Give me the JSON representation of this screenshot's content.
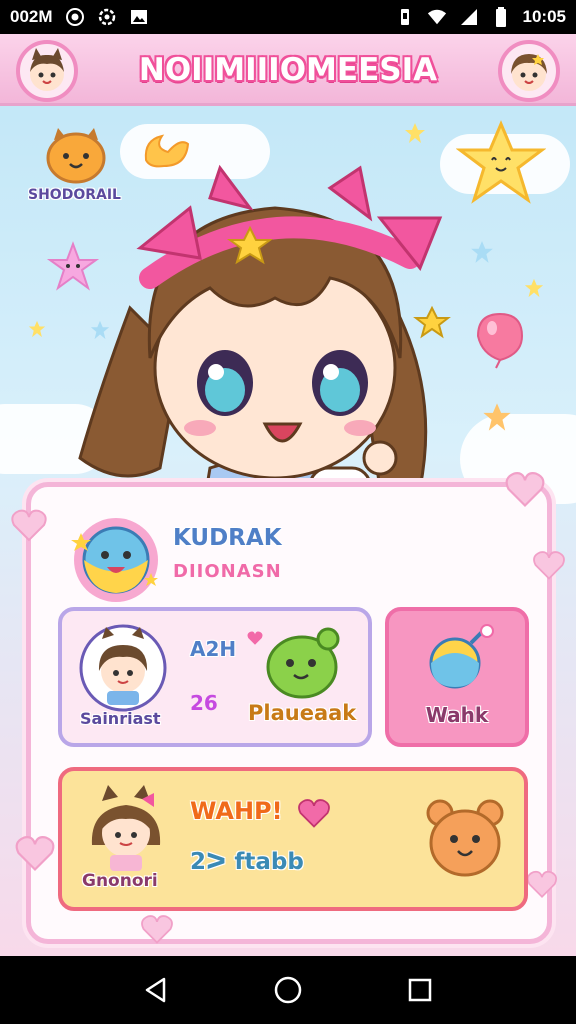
{
  "status_bar": {
    "left_text": "002M",
    "time": "10:05",
    "icons": [
      "record-icon",
      "settings-icon",
      "image-icon",
      "vibrate-icon",
      "wifi-icon",
      "signal-icon",
      "battery-icon"
    ]
  },
  "header": {
    "title": "NOIIMIIIOMEESIA",
    "left_avatar": "cat-girl-avatar",
    "right_avatar": "girl-avatar"
  },
  "stickers": {
    "top_left_label": "SHODORAIL",
    "icons": [
      "cat-sticker-icon",
      "star-face-icon",
      "balloon-icon",
      "sparkle-star-icon"
    ]
  },
  "profile": {
    "name": "KUDRAK",
    "subtitle": "DIIONASN",
    "avatar": "sun-creature-avatar"
  },
  "cards": {
    "card_a": {
      "top_text": "A2H",
      "mid_text": "26",
      "left_caption": "Sainriast",
      "right_caption": "Plaueaak"
    },
    "card_b": {
      "caption": "Wahk"
    },
    "card_c": {
      "headline": "WAHP!",
      "mid_text": "2ᐳ ftabb",
      "caption": "Gnonori"
    }
  },
  "colors": {
    "accent_pink": "#f0509a",
    "panel_border": "#f4b5d8",
    "card_purple_border": "#b9a6e8",
    "card_yellow": "#fce39a"
  },
  "nav": {
    "back": "back-icon",
    "home": "home-icon",
    "recents": "recents-icon"
  }
}
